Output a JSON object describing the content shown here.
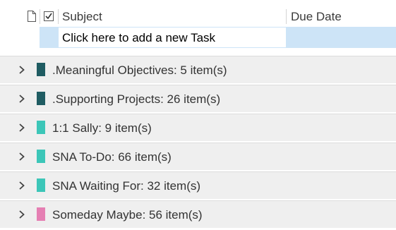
{
  "header": {
    "subject_label": "Subject",
    "due_date_label": "Due Date",
    "icons": [
      "document-icon",
      "checkbox-icon"
    ]
  },
  "new_task": {
    "placeholder": "Click here to add a new Task"
  },
  "groups": [
    {
      "label": ".Meaningful Objectives: 5 item(s)",
      "color": "#1f5c62",
      "expanded": false
    },
    {
      "label": ".Supporting Projects: 26 item(s)",
      "color": "#1f5c62",
      "expanded": false
    },
    {
      "label": "1:1 Sally: 9 item(s)",
      "color": "#3cc6b8",
      "expanded": false
    },
    {
      "label": "SNA To-Do: 66 item(s)",
      "color": "#3cc6b8",
      "expanded": false
    },
    {
      "label": "SNA Waiting For: 32 item(s)",
      "color": "#3cc6b8",
      "expanded": false
    },
    {
      "label": "Someday Maybe: 56 item(s)",
      "color": "#e57fb3",
      "expanded": false
    }
  ]
}
